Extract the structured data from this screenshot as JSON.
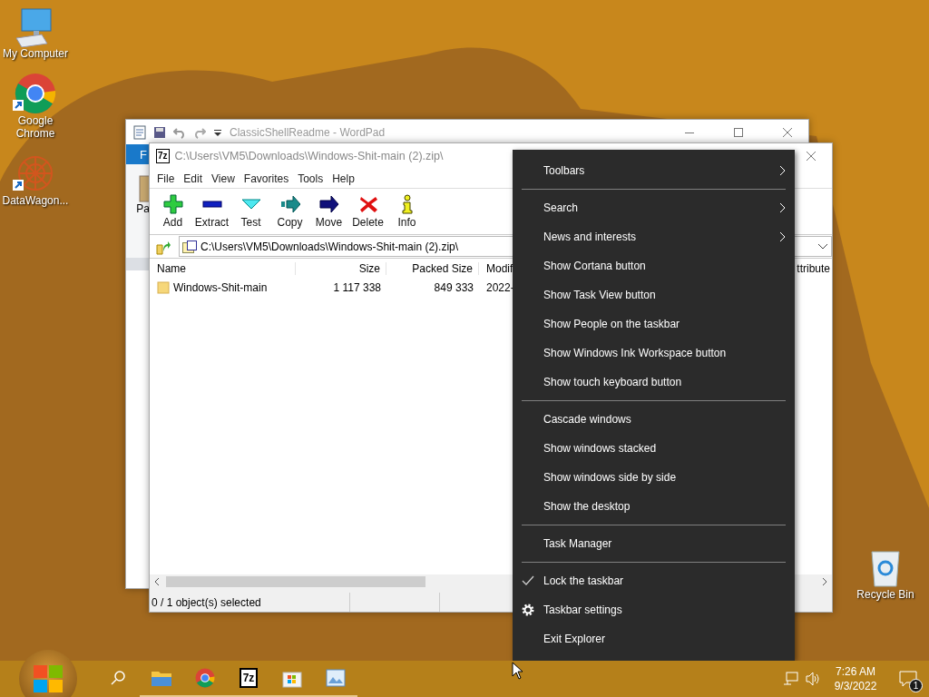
{
  "desktop_icons": [
    {
      "label": "My Computer",
      "kind": "computer",
      "shortcut": false
    },
    {
      "label": "Google Chrome",
      "kind": "browser",
      "shortcut": true
    },
    {
      "label": "DataWagon...",
      "kind": "app",
      "shortcut": true
    }
  ],
  "recycle_bin": {
    "label": "Recycle Bin"
  },
  "wordpad": {
    "title": "ClassicShellReadme - WordPad",
    "ribbon_tab": "F",
    "ribbon_button": "Pa"
  },
  "archive_window": {
    "icon_text": "7z",
    "title": "C:\\Users\\VM5\\Downloads\\Windows-Shit-main (2).zip\\",
    "menu": [
      "File",
      "Edit",
      "View",
      "Favorites",
      "Tools",
      "Help"
    ],
    "toolbar": [
      {
        "label": "Add",
        "kind": "add"
      },
      {
        "label": "Extract",
        "kind": "extract"
      },
      {
        "label": "Test",
        "kind": "test"
      },
      {
        "label": "Copy",
        "kind": "copy"
      },
      {
        "label": "Move",
        "kind": "move"
      },
      {
        "label": "Delete",
        "kind": "delete"
      },
      {
        "label": "Info",
        "kind": "info"
      }
    ],
    "address": "C:\\Users\\VM5\\Downloads\\Windows-Shit-main (2).zip\\",
    "columns": [
      "Name",
      "Size",
      "Packed Size",
      "Modif",
      "ttribute"
    ],
    "rows": [
      {
        "cells": [
          "Windows-Shit-main",
          "1 117 338",
          "849 333",
          "2022-"
        ],
        "selected": false
      }
    ],
    "status": "0 / 1 object(s) selected"
  },
  "context_menu": [
    {
      "kind": "submenu",
      "label": "Toolbars",
      "checked": false
    },
    {
      "kind": "separator"
    },
    {
      "kind": "submenu",
      "label": "Search",
      "checked": false
    },
    {
      "kind": "submenu",
      "label": "News and interests",
      "checked": false
    },
    {
      "kind": "command",
      "label": "Show Cortana button",
      "checked": false
    },
    {
      "kind": "command",
      "label": "Show Task View button",
      "checked": false
    },
    {
      "kind": "command",
      "label": "Show People on the taskbar",
      "checked": false
    },
    {
      "kind": "command",
      "label": "Show Windows Ink Workspace button",
      "checked": false
    },
    {
      "kind": "command",
      "label": "Show touch keyboard button",
      "checked": false
    },
    {
      "kind": "separator"
    },
    {
      "kind": "command",
      "label": "Cascade windows",
      "checked": false
    },
    {
      "kind": "command",
      "label": "Show windows stacked",
      "checked": false
    },
    {
      "kind": "command",
      "label": "Show windows side by side",
      "checked": false
    },
    {
      "kind": "command",
      "label": "Show the desktop",
      "checked": false
    },
    {
      "kind": "separator"
    },
    {
      "kind": "command",
      "label": "Task Manager",
      "checked": false
    },
    {
      "kind": "separator"
    },
    {
      "kind": "command",
      "label": "Lock the taskbar",
      "checked": true
    },
    {
      "kind": "settings",
      "label": "Taskbar settings",
      "checked": false
    },
    {
      "kind": "command",
      "label": "Exit Explorer",
      "checked": false
    }
  ],
  "taskbar": {
    "apps": [
      {
        "kind": "folder",
        "running": true
      },
      {
        "kind": "browser",
        "running": true
      },
      {
        "kind": "archive",
        "icon_text": "7z",
        "running": true
      },
      {
        "kind": "store",
        "running": true
      },
      {
        "kind": "paint",
        "running": true
      }
    ],
    "clock": {
      "time": "7:26 AM",
      "date": "9/3/2022"
    },
    "notification_count": "1"
  }
}
